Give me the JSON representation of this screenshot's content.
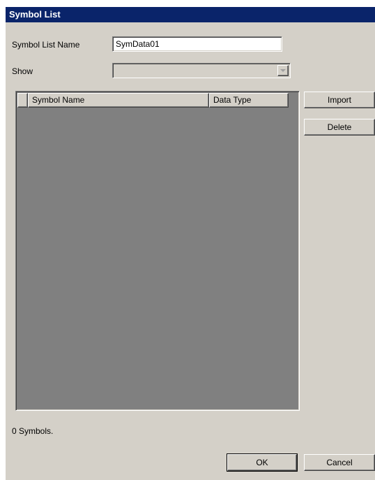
{
  "window": {
    "title": "Symbol List"
  },
  "form": {
    "name_label": "Symbol List Name",
    "name_value": "SymData01",
    "show_label": "Show",
    "show_value": ""
  },
  "table": {
    "columns": [
      "",
      "Symbol Name",
      "Data Type"
    ],
    "rows": []
  },
  "buttons": {
    "import": "Import",
    "delete": "Delete",
    "ok": "OK",
    "cancel": "Cancel"
  },
  "status": {
    "count_text": "0  Symbols."
  },
  "colors": {
    "titlebar": "#0a246a",
    "dialog_bg": "#d4d0c8",
    "list_bg": "#808080"
  },
  "icons": {
    "combo_arrow": "chevron-down-icon"
  }
}
